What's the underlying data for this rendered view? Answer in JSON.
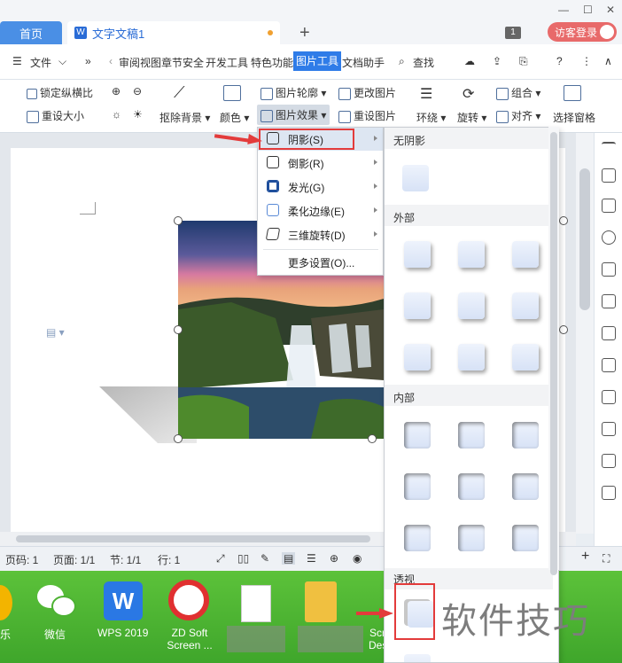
{
  "tabs": {
    "home": "首页",
    "doc": "文字文稿1"
  },
  "title_right": {
    "badge": "1",
    "login": "访客登录"
  },
  "menu": {
    "file": "文件",
    "items": [
      "审阅",
      "视图",
      "章节",
      "安全",
      "开发工具",
      "特色功能",
      "图片工具",
      "文档助手"
    ],
    "search": "查找"
  },
  "ribbon": {
    "lock_ratio": "锁定纵横比",
    "reset_size": "重设大小",
    "remove_bg": "抠除背景",
    "color": "颜色",
    "pic_outline": "图片轮廓",
    "pic_effect": "图片效果",
    "change_pic": "更改图片",
    "reset_pic": "重设图片",
    "wrap": "环绕",
    "rotate": "旋转",
    "group": "组合",
    "align": "对齐",
    "select_pane": "选择窗格"
  },
  "dropdown": {
    "items": [
      "阴影(S)",
      "倒影(R)",
      "发光(G)",
      "柔化边缘(E)",
      "三维旋转(D)"
    ],
    "more": "更多设置(O)..."
  },
  "panel": {
    "no_shadow": "无阴影",
    "outer": "外部",
    "inner": "内部",
    "perspective": "透视"
  },
  "status": {
    "page_code": "页码: 1",
    "page": "页面: 1/1",
    "section": "节: 1/1",
    "row": "行: 1"
  },
  "taskbar": {
    "items": [
      "乐",
      "微信",
      "WPS 2019",
      "ZD Soft Screen ...",
      "",
      "Scr Des"
    ]
  },
  "watermark": "软件技巧",
  "colors": {
    "accent": "#2f7ce8",
    "highlight": "#e33b3b",
    "taskbar": "#4db233"
  }
}
